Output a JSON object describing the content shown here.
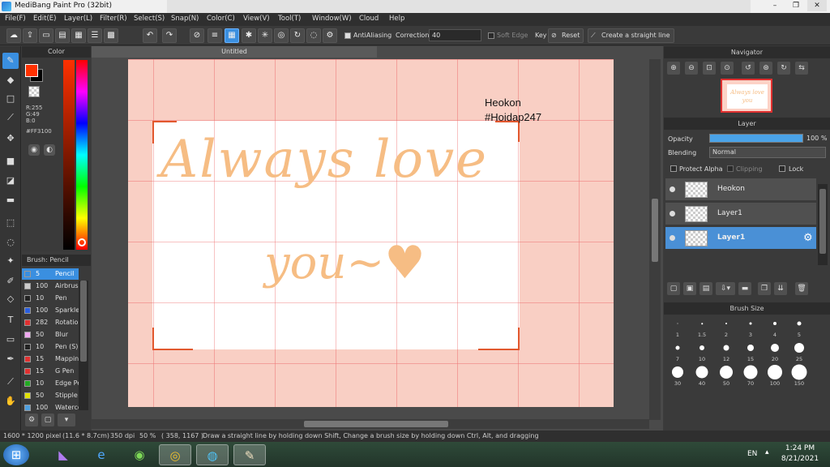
{
  "window": {
    "title": "MediBang Paint Pro (32bit)",
    "controls": [
      "–",
      "❐",
      "✕"
    ]
  },
  "menu": [
    "File(F)",
    "Edit(E)",
    "Layer(L)",
    "Filter(R)",
    "Select(S)",
    "Snap(N)",
    "Color(C)",
    "View(V)",
    "Tool(T)",
    "Window(W)",
    "Cloud",
    "Help"
  ],
  "toolbar": {
    "antialiasing_label": "AntiAliasing",
    "correction_label": "Correction",
    "correction_value": "40",
    "soft_edge_label": "Soft Edge",
    "key_label": "Key",
    "reset_label": "Reset",
    "straight_line_label": "Create a straight line"
  },
  "color_panel": {
    "title": "Color",
    "fg_color": "#FF3100",
    "rgb": [
      "R:255",
      "G:49",
      "B:0"
    ],
    "hex": "#FF3100"
  },
  "brush_panel": {
    "title": "Brush: Pencil",
    "brushes": [
      {
        "size": "5",
        "name": "Pencil",
        "color": "#3a8fe0",
        "selected": true
      },
      {
        "size": "100",
        "name": "Airbrush",
        "color": "#cccccc"
      },
      {
        "size": "10",
        "name": "Pen",
        "color": "#222222"
      },
      {
        "size": "100",
        "name": "Sparkle",
        "color": "#2a5fe0"
      },
      {
        "size": "282",
        "name": "Rotation",
        "color": "#e03030"
      },
      {
        "size": "50",
        "name": "Blur",
        "color": "#f0a8f0"
      },
      {
        "size": "10",
        "name": "Pen (S)",
        "color": "#222222"
      },
      {
        "size": "15",
        "name": "Mapping",
        "color": "#e03030"
      },
      {
        "size": "15",
        "name": "G Pen",
        "color": "#e03030"
      },
      {
        "size": "10",
        "name": "Edge Pen",
        "color": "#22aa22"
      },
      {
        "size": "50",
        "name": "Stipple",
        "color": "#e0e000"
      },
      {
        "size": "100",
        "name": "Watercolor",
        "color": "#4fa0e0"
      }
    ]
  },
  "canvas": {
    "tab_title": "Untitled",
    "headline": "Always love",
    "subline": "you~♥",
    "signature": [
      "Heokon",
      "#Hoidap247"
    ],
    "doc_bg": "#F9CFC4",
    "lettering_color": "#F6BD84"
  },
  "navigator": {
    "title": "Navigator",
    "thumb_text": "Always love you"
  },
  "layer_panel": {
    "title": "Layer",
    "opacity_label": "Opacity",
    "opacity_value": "100 %",
    "opacity_pct": 100,
    "blending_label": "Blending",
    "blending_value": "Normal",
    "protect_alpha": "Protect Alpha",
    "clipping": "Clipping",
    "lock": "Lock",
    "layers": [
      {
        "name": "Heokon",
        "selected": false
      },
      {
        "name": "Layer1",
        "selected": false
      },
      {
        "name": "Layer1",
        "selected": true
      }
    ]
  },
  "brush_size": {
    "title": "Brush Size",
    "sizes": [
      "1",
      "1.5",
      "2",
      "3",
      "4",
      "5",
      "7",
      "10",
      "12",
      "15",
      "20",
      "25",
      "30",
      "40",
      "50",
      "70",
      "100",
      "150"
    ]
  },
  "status": {
    "dimensions": "1600 * 1200 pixel",
    "physical": "(11.6 * 8.7cm)",
    "dpi": "350 dpi",
    "zoom": "50 %",
    "coords": "( 358, 1167 )",
    "hint": "Draw a straight line by holding down Shift, Change a brush size by holding down Ctrl, Alt, and dragging"
  },
  "taskbar": {
    "lang": "EN",
    "time": "1:24 PM",
    "date": "8/21/2021"
  }
}
